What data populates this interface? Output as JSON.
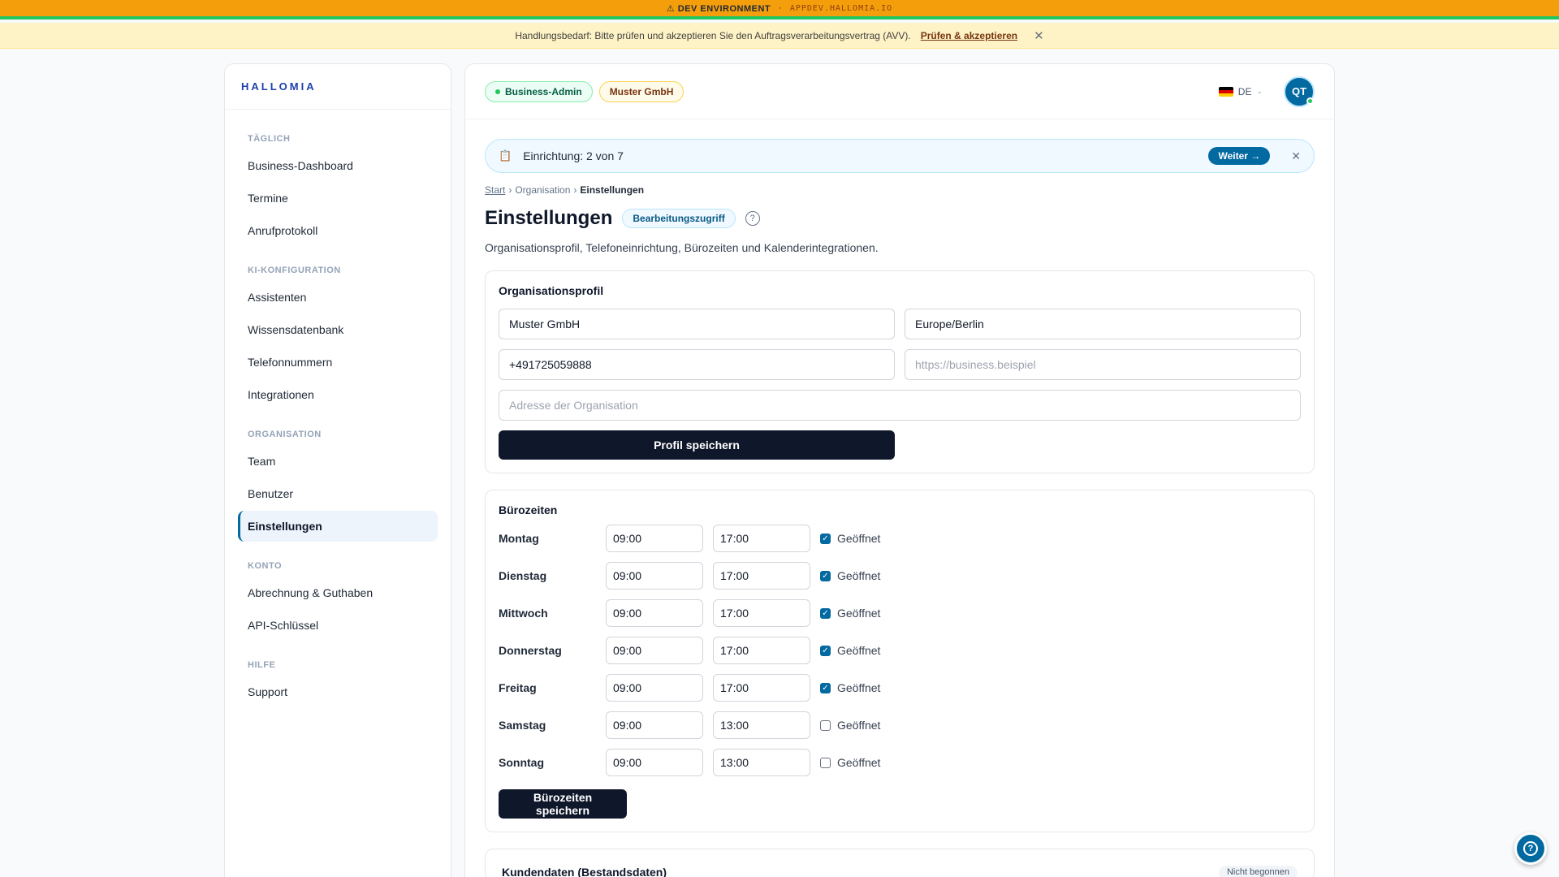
{
  "dev_banner": {
    "label": "⚠ DEV ENVIRONMENT",
    "separator": "·",
    "host": "APPDEV.HALLOMIA.IO"
  },
  "notice": {
    "text": "Handlungsbedarf: Bitte prüfen und akzeptieren Sie den Auftragsverarbeitungsvertrag (AVV).",
    "link": "Prüfen & akzeptieren",
    "close": "✕"
  },
  "sidebar": {
    "brand": "HALLOMIA",
    "sections": [
      {
        "title": "TÄGLICH",
        "items": [
          "Business-Dashboard",
          "Termine",
          "Anrufprotokoll"
        ]
      },
      {
        "title": "KI-KONFIGURATION",
        "items": [
          "Assistenten",
          "Wissensdatenbank",
          "Telefonnummern",
          "Integrationen"
        ]
      },
      {
        "title": "ORGANISATION",
        "items": [
          "Team",
          "Benutzer",
          "Einstellungen"
        ]
      },
      {
        "title": "KONTO",
        "items": [
          "Abrechnung & Guthaben",
          "API-Schlüssel"
        ]
      },
      {
        "title": "HILFE",
        "items": [
          "Support"
        ]
      }
    ],
    "active_item": "Einstellungen"
  },
  "topbar": {
    "role_pill": "Business-Admin",
    "org_pill": "Muster GmbH",
    "language": "DE",
    "avatar_initials": "QT"
  },
  "setup": {
    "icon": "📋",
    "text": "Einrichtung: 2 von 7",
    "next_label": "Weiter →",
    "close": "✕"
  },
  "breadcrumb": {
    "start": "Start",
    "sep": "›",
    "org": "Organisation",
    "current": "Einstellungen"
  },
  "page": {
    "title": "Einstellungen",
    "access_badge": "Bearbeitungszugriff",
    "help": "?",
    "subtitle": "Organisationsprofil, Telefoneinrichtung, Bürozeiten und Kalenderintegrationen."
  },
  "profile": {
    "title": "Organisationsprofil",
    "name_value": "Muster GmbH",
    "timezone_value": "Europe/Berlin",
    "phone_value": "+491725059888",
    "website_placeholder": "https://business.beispiel",
    "address_placeholder": "Adresse der Organisation",
    "save_label": "Profil speichern"
  },
  "hours": {
    "title": "Bürozeiten",
    "open_label": "Geöffnet",
    "days": [
      {
        "day": "Montag",
        "from": "09:00",
        "to": "17:00",
        "open": true
      },
      {
        "day": "Dienstag",
        "from": "09:00",
        "to": "17:00",
        "open": true
      },
      {
        "day": "Mittwoch",
        "from": "09:00",
        "to": "17:00",
        "open": true
      },
      {
        "day": "Donnerstag",
        "from": "09:00",
        "to": "17:00",
        "open": true
      },
      {
        "day": "Freitag",
        "from": "09:00",
        "to": "17:00",
        "open": true
      },
      {
        "day": "Samstag",
        "from": "09:00",
        "to": "13:00",
        "open": false
      },
      {
        "day": "Sonntag",
        "from": "09:00",
        "to": "13:00",
        "open": false
      }
    ],
    "save_label": "Bürozeiten speichern"
  },
  "next_section": {
    "title": "Kundendaten (Bestandsdaten)",
    "tag": "Nicht begonnen"
  },
  "fab": {
    "icon": "?"
  },
  "colors": {
    "accent": "#0369a1",
    "dark": "#0f172a",
    "dev": "#f59e0b"
  }
}
